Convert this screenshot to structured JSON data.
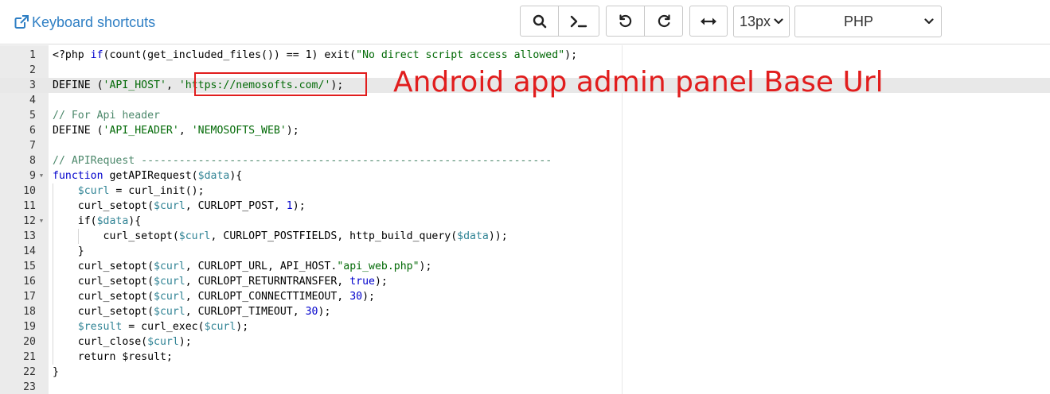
{
  "toolbar": {
    "keyboard_shortcuts_label": "Keyboard shortcuts",
    "font_size_value": "13px",
    "language_value": "PHP"
  },
  "annotation": {
    "label": "Android app admin panel Base Url",
    "color": "#e11d1d"
  },
  "editor": {
    "active_line": 3,
    "lines": [
      {
        "n": "1",
        "fold": false,
        "tokens": [
          [
            "p",
            "<?php "
          ],
          [
            "k",
            "if"
          ],
          [
            "p",
            "(count(get_included_files()) == 1) exit("
          ],
          [
            "s",
            "\"No direct script access allowed\""
          ],
          [
            "p",
            ");"
          ]
        ]
      },
      {
        "n": "2",
        "fold": false,
        "tokens": []
      },
      {
        "n": "3",
        "fold": false,
        "tokens": [
          [
            "p",
            "DEFINE ("
          ],
          [
            "s",
            "'API_HOST'"
          ],
          [
            "p",
            ", "
          ],
          [
            "s",
            "'https://nemosofts.com/'"
          ],
          [
            "p",
            ");"
          ]
        ]
      },
      {
        "n": "4",
        "fold": false,
        "tokens": []
      },
      {
        "n": "5",
        "fold": false,
        "tokens": [
          [
            "c",
            "// For Api header"
          ]
        ]
      },
      {
        "n": "6",
        "fold": false,
        "tokens": [
          [
            "p",
            "DEFINE ("
          ],
          [
            "s",
            "'API_HEADER'"
          ],
          [
            "p",
            ", "
          ],
          [
            "s",
            "'NEMOSOFTS_WEB'"
          ],
          [
            "p",
            ");"
          ]
        ]
      },
      {
        "n": "7",
        "fold": false,
        "tokens": []
      },
      {
        "n": "8",
        "fold": false,
        "tokens": [
          [
            "c",
            "// APIRequest -----------------------------------------------------------------"
          ]
        ]
      },
      {
        "n": "9",
        "fold": true,
        "tokens": [
          [
            "k",
            "function"
          ],
          [
            "p",
            " getAPIRequest("
          ],
          [
            "v",
            "$data"
          ],
          [
            "p",
            "){"
          ]
        ]
      },
      {
        "n": "10",
        "fold": false,
        "tokens": [
          [
            "p",
            "    "
          ],
          [
            "v",
            "$curl"
          ],
          [
            "p",
            " = curl_init();"
          ]
        ]
      },
      {
        "n": "11",
        "fold": false,
        "tokens": [
          [
            "p",
            "    curl_setopt("
          ],
          [
            "v",
            "$curl"
          ],
          [
            "p",
            ", CURLOPT_POST, "
          ],
          [
            "k",
            "1"
          ],
          [
            "p",
            ");"
          ]
        ]
      },
      {
        "n": "12",
        "fold": true,
        "tokens": [
          [
            "p",
            "    if("
          ],
          [
            "v",
            "$data"
          ],
          [
            "p",
            "){"
          ]
        ]
      },
      {
        "n": "13",
        "fold": false,
        "tokens": [
          [
            "p",
            "        curl_setopt("
          ],
          [
            "v",
            "$curl"
          ],
          [
            "p",
            ", CURLOPT_POSTFIELDS, http_build_query("
          ],
          [
            "v",
            "$data"
          ],
          [
            "p",
            "));"
          ]
        ]
      },
      {
        "n": "14",
        "fold": false,
        "tokens": [
          [
            "p",
            "    }"
          ]
        ]
      },
      {
        "n": "15",
        "fold": false,
        "tokens": [
          [
            "p",
            "    curl_setopt("
          ],
          [
            "v",
            "$curl"
          ],
          [
            "p",
            ", CURLOPT_URL, API_HOST."
          ],
          [
            "s",
            "\"api_web.php\""
          ],
          [
            "p",
            ");"
          ]
        ]
      },
      {
        "n": "16",
        "fold": false,
        "tokens": [
          [
            "p",
            "    curl_setopt("
          ],
          [
            "v",
            "$curl"
          ],
          [
            "p",
            ", CURLOPT_RETURNTRANSFER, "
          ],
          [
            "k",
            "true"
          ],
          [
            "p",
            ");"
          ]
        ]
      },
      {
        "n": "17",
        "fold": false,
        "tokens": [
          [
            "p",
            "    curl_setopt("
          ],
          [
            "v",
            "$curl"
          ],
          [
            "p",
            ", CURLOPT_CONNECTTIMEOUT, "
          ],
          [
            "k",
            "30"
          ],
          [
            "p",
            ");"
          ]
        ]
      },
      {
        "n": "18",
        "fold": false,
        "tokens": [
          [
            "p",
            "    curl_setopt("
          ],
          [
            "v",
            "$curl"
          ],
          [
            "p",
            ", CURLOPT_TIMEOUT, "
          ],
          [
            "k",
            "30"
          ],
          [
            "p",
            ");"
          ]
        ]
      },
      {
        "n": "19",
        "fold": false,
        "tokens": [
          [
            "p",
            "    "
          ],
          [
            "v",
            "$result"
          ],
          [
            "p",
            " = curl_exec("
          ],
          [
            "v",
            "$curl"
          ],
          [
            "p",
            ");"
          ]
        ]
      },
      {
        "n": "20",
        "fold": false,
        "tokens": [
          [
            "p",
            "    curl_close("
          ],
          [
            "v",
            "$curl"
          ],
          [
            "p",
            ");"
          ]
        ]
      },
      {
        "n": "21",
        "fold": false,
        "tokens": [
          [
            "p",
            "    return $result;"
          ]
        ]
      },
      {
        "n": "22",
        "fold": false,
        "tokens": [
          [
            "p",
            "}"
          ]
        ]
      },
      {
        "n": "23",
        "fold": false,
        "tokens": []
      }
    ]
  }
}
